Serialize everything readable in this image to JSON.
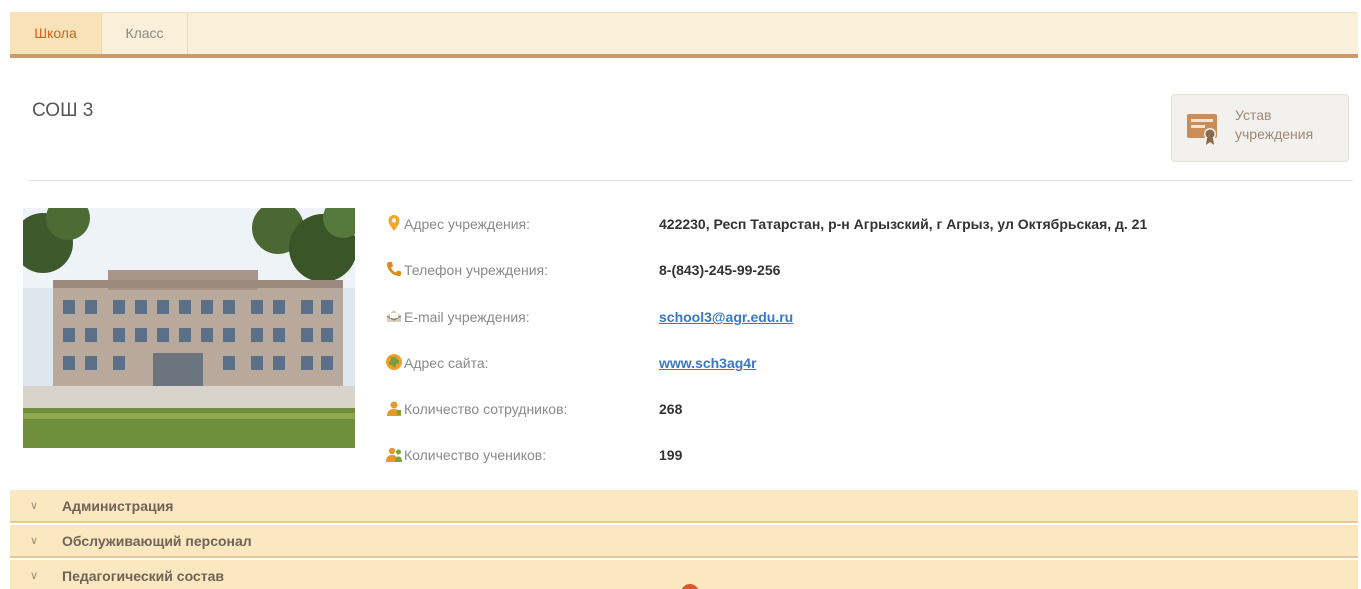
{
  "tabs": [
    {
      "label": "Школа",
      "active": true
    },
    {
      "label": "Класс",
      "active": false
    }
  ],
  "school": {
    "title": "СОШ 3",
    "charter_button": {
      "line1": "Устав",
      "line2": "учреждения",
      "icon": "certificate-icon"
    }
  },
  "info": [
    {
      "icon": "map-pin-icon",
      "label": "Адрес учреждения:",
      "value": "422230, Респ Татарстан, р-н Агрызский, г Агрыз, ул Октябрьская, д. 21",
      "link": false
    },
    {
      "icon": "phone-icon",
      "label": "Телефон учреждения:",
      "value": "8-(843)-245-99-256",
      "link": false
    },
    {
      "icon": "mail-icon",
      "label": "E-mail учреждения:",
      "value": "school3@agr.edu.ru",
      "link": true
    },
    {
      "icon": "globe-icon",
      "label": "Адрес сайта:",
      "value": "www.sch3ag4r",
      "link": true
    },
    {
      "icon": "staff-icon",
      "label": "Количество сотрудников:",
      "value": "268",
      "link": false
    },
    {
      "icon": "students-icon",
      "label": "Количество учеников:",
      "value": "199",
      "link": false
    }
  ],
  "accordion": [
    {
      "label": "Администрация"
    },
    {
      "label": "Обслуживающий персонал"
    },
    {
      "label": "Педагогический состав"
    }
  ],
  "colors": {
    "accent": "#d0621f",
    "tab_bg": "#faf0d9",
    "accordion_bg": "#fbe7c0",
    "link": "#3a78c3"
  }
}
